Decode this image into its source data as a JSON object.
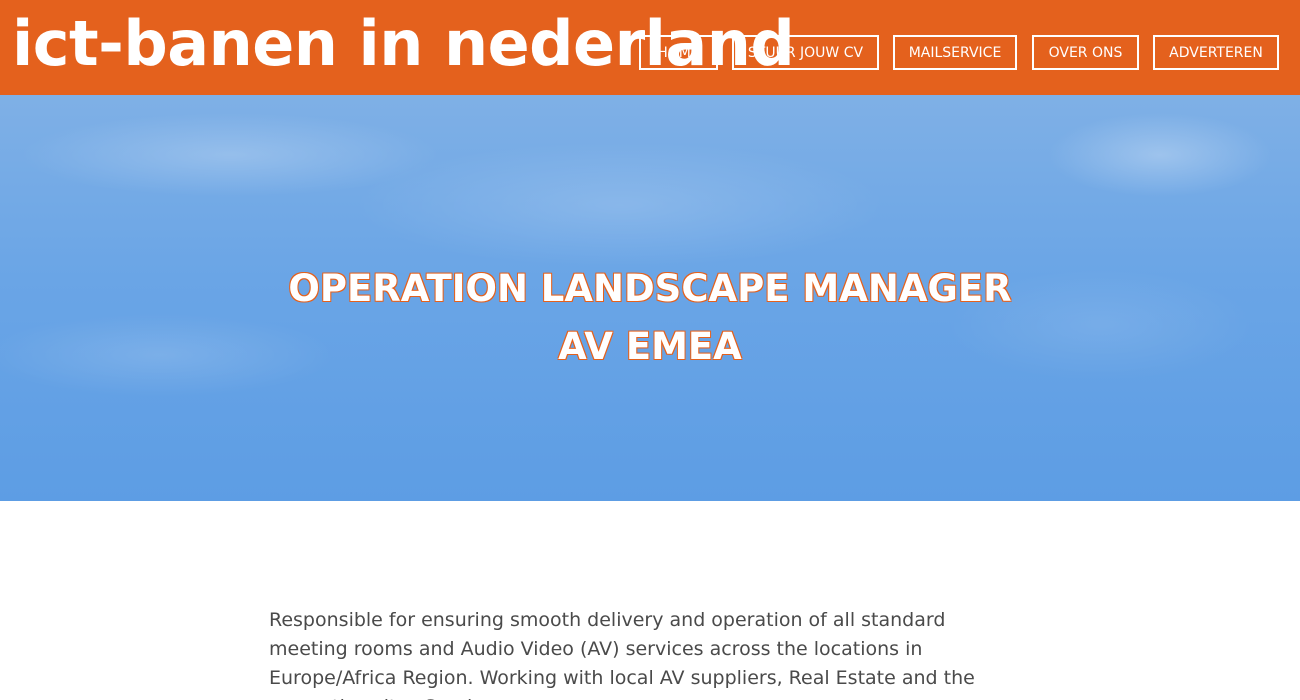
{
  "header": {
    "site_title": "ict-banen in nederland",
    "brand_color": "#e4611d"
  },
  "nav": {
    "items": [
      {
        "label": "HOME"
      },
      {
        "label": "STUUR JOUW CV"
      },
      {
        "label": "MAILSERVICE"
      },
      {
        "label": "OVER ONS"
      },
      {
        "label": "ADVERTEREN"
      }
    ]
  },
  "hero": {
    "title": "OPERATION LANDSCAPE MANAGER AV EMEA",
    "background": "sky-blue clouds"
  },
  "content": {
    "body": "Responsible for ensuring smooth delivery and operation of all standard meeting rooms and Audio Video (AV) services across the locations in Europe/Africa Region. Working with local AV suppliers, Real Estate and the respective sites Service"
  }
}
